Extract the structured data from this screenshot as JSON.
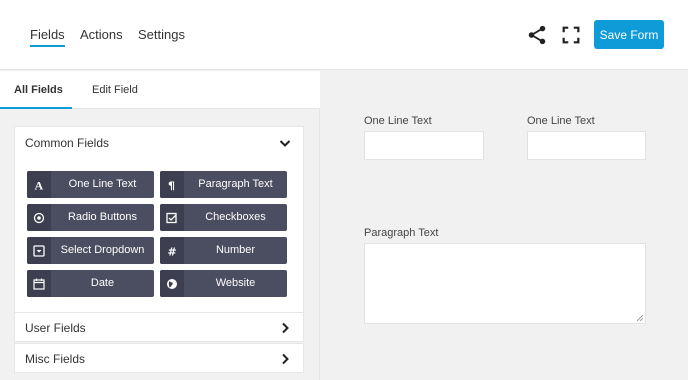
{
  "nav": {
    "tabs": [
      {
        "label": "Fields",
        "active": true
      },
      {
        "label": "Actions",
        "active": false
      },
      {
        "label": "Settings",
        "active": false
      }
    ],
    "share_icon": "share-icon",
    "fullscreen_icon": "fullscreen-icon",
    "save_label": "Save Form"
  },
  "sidebar": {
    "tabs": [
      {
        "label": "All Fields",
        "active": true
      },
      {
        "label": "Edit Field",
        "active": false
      }
    ],
    "common": {
      "title": "Common Fields",
      "expanded": true,
      "fields": [
        {
          "label": "One Line Text",
          "icon": "text-icon"
        },
        {
          "label": "Paragraph Text",
          "icon": "paragraph-icon"
        },
        {
          "label": "Radio Buttons",
          "icon": "radio-icon"
        },
        {
          "label": "Checkboxes",
          "icon": "checkbox-icon"
        },
        {
          "label": "Select Dropdown",
          "icon": "dropdown-icon"
        },
        {
          "label": "Number",
          "icon": "hash-icon"
        },
        {
          "label": "Date",
          "icon": "calendar-icon"
        },
        {
          "label": "Website",
          "icon": "globe-icon"
        }
      ]
    },
    "user_fields": {
      "title": "User Fields",
      "expanded": false
    },
    "misc_fields": {
      "title": "Misc Fields",
      "expanded": false
    }
  },
  "form": {
    "fields": [
      {
        "label": "One Line Text",
        "value": ""
      },
      {
        "label": "One Line Text",
        "value": ""
      },
      {
        "label": "Paragraph Text",
        "value": ""
      }
    ]
  },
  "colors": {
    "accent": "#0e9bd8",
    "field_button": "#4b4d60"
  }
}
